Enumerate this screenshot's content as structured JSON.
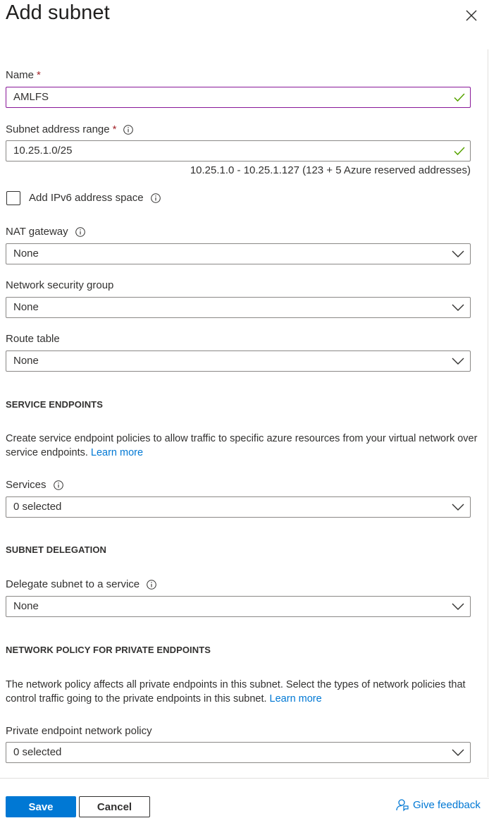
{
  "panel": {
    "title": "Add subnet"
  },
  "icons": {
    "close": "close-icon",
    "info": "info-icon",
    "check": "checkmark-icon",
    "chevron": "chevron-down-icon",
    "feedback": "feedback-person-icon"
  },
  "colors": {
    "accent": "#0078d4",
    "valid": "#57a300",
    "focus_border": "#881798",
    "required": "#a4262c"
  },
  "name_field": {
    "label": "Name",
    "required_mark": "*",
    "value": "AMLFS"
  },
  "subnet_range": {
    "label": "Subnet address range",
    "required_mark": "*",
    "value": "10.25.1.0/25",
    "hint": "10.25.1.0 - 10.25.1.127 (123 + 5 Azure reserved addresses)"
  },
  "ipv6": {
    "label": "Add IPv6 address space",
    "checked": false
  },
  "nat_gateway": {
    "label": "NAT gateway",
    "value": "None"
  },
  "nsg": {
    "label": "Network security group",
    "value": "None"
  },
  "route_table": {
    "label": "Route table",
    "value": "None"
  },
  "service_endpoints": {
    "heading": "SERVICE ENDPOINTS",
    "description": "Create service endpoint policies to allow traffic to specific azure resources from your virtual network over service endpoints.",
    "learn_more": "Learn more",
    "services_label": "Services",
    "services_value": "0 selected"
  },
  "subnet_delegation": {
    "heading": "SUBNET DELEGATION",
    "label": "Delegate subnet to a service",
    "value": "None"
  },
  "network_policy": {
    "heading": "NETWORK POLICY FOR PRIVATE ENDPOINTS",
    "description": "The network policy affects all private endpoints in this subnet. Select the types of network policies that control traffic going to the private endpoints in this subnet.",
    "learn_more": "Learn more",
    "label": "Private endpoint network policy",
    "value": "0 selected"
  },
  "footer": {
    "save_label": "Save",
    "cancel_label": "Cancel",
    "feedback_label": "Give feedback"
  }
}
